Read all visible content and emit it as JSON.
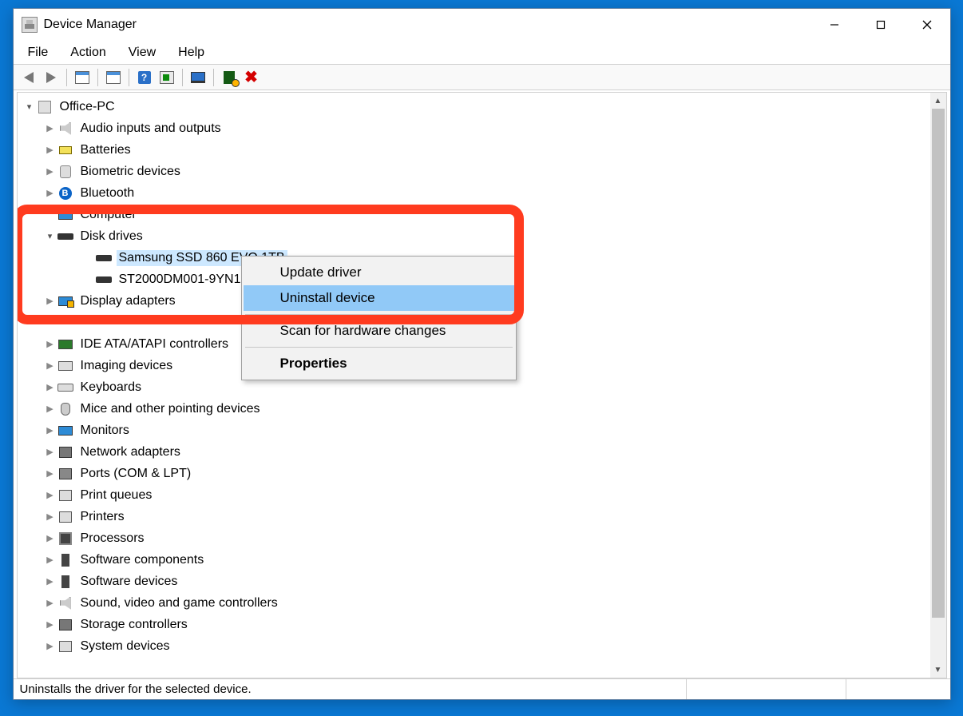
{
  "window": {
    "title": "Device Manager"
  },
  "menus": {
    "file": "File",
    "action": "Action",
    "view": "View",
    "help": "Help"
  },
  "tree": {
    "root": "Office-PC",
    "categories": [
      {
        "expander": ">",
        "icon": "audio",
        "label": "Audio inputs and outputs"
      },
      {
        "expander": ">",
        "icon": "batt",
        "label": "Batteries"
      },
      {
        "expander": ">",
        "icon": "bio",
        "label": "Biometric devices"
      },
      {
        "expander": ">",
        "icon": "bt",
        "label": "Bluetooth"
      },
      {
        "expander": "",
        "icon": "mon",
        "label": "Computer"
      },
      {
        "expander": "v",
        "icon": "disk",
        "label": "Disk drives",
        "children": [
          {
            "icon": "disk",
            "label": "Samsung SSD 860 EVO 1TB",
            "selected": true
          },
          {
            "icon": "disk",
            "label": "ST2000DM001-9YN1"
          }
        ]
      },
      {
        "expander": ">",
        "icon": "display",
        "label": "Display adapters"
      },
      {
        "expander": "",
        "icon": "generic",
        "label": ""
      },
      {
        "expander": ">",
        "icon": "ide",
        "label": "IDE ATA/ATAPI controllers"
      },
      {
        "expander": ">",
        "icon": "img",
        "label": "Imaging devices"
      },
      {
        "expander": ">",
        "icon": "kb",
        "label": "Keyboards"
      },
      {
        "expander": ">",
        "icon": "mouse",
        "label": "Mice and other pointing devices"
      },
      {
        "expander": ">",
        "icon": "mon",
        "label": "Monitors"
      },
      {
        "expander": ">",
        "icon": "net",
        "label": "Network adapters"
      },
      {
        "expander": ">",
        "icon": "port",
        "label": "Ports (COM & LPT)"
      },
      {
        "expander": ">",
        "icon": "printq",
        "label": "Print queues"
      },
      {
        "expander": ">",
        "icon": "printq",
        "label": "Printers"
      },
      {
        "expander": ">",
        "icon": "cpu",
        "label": "Processors"
      },
      {
        "expander": ">",
        "icon": "swc",
        "label": "Software components"
      },
      {
        "expander": ">",
        "icon": "swc",
        "label": "Software devices"
      },
      {
        "expander": ">",
        "icon": "sound",
        "label": "Sound, video and game controllers"
      },
      {
        "expander": ">",
        "icon": "storage",
        "label": "Storage controllers"
      },
      {
        "expander": ">",
        "icon": "sys",
        "label": "System devices"
      }
    ]
  },
  "context_menu": {
    "items": [
      {
        "label": "Update driver",
        "hover": false
      },
      {
        "label": "Uninstall device",
        "hover": true
      },
      {
        "sep": true
      },
      {
        "label": "Scan for hardware changes",
        "hover": false
      },
      {
        "sep": true
      },
      {
        "label": "Properties",
        "hover": false,
        "bold": true
      }
    ]
  },
  "statusbar": {
    "text": "Uninstalls the driver for the selected device."
  }
}
